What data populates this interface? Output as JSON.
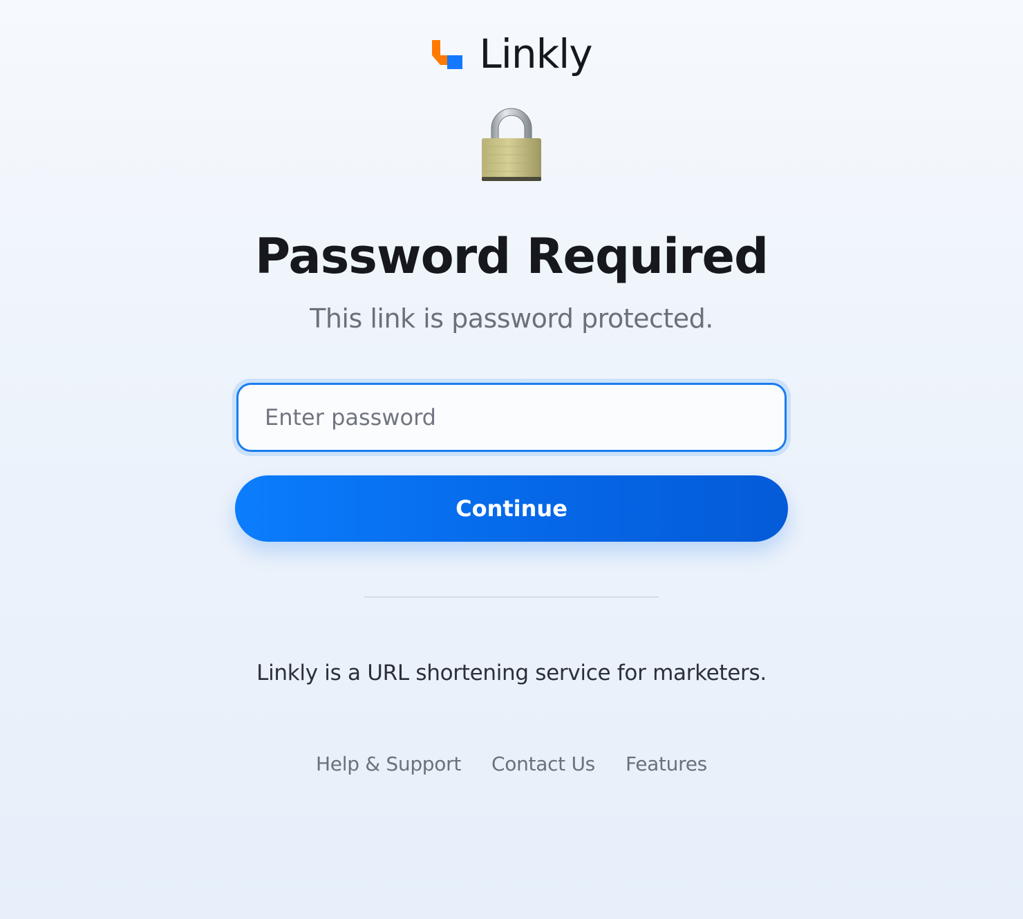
{
  "brand": {
    "name": "Linkly",
    "colors": {
      "orange": "#ff7a00",
      "blue": "#1479ff",
      "accent": "#0a7dfd"
    }
  },
  "lock_icon": "padlock-icon",
  "heading": "Password Required",
  "subheading": "This link is password protected.",
  "password_field": {
    "placeholder": "Enter password",
    "value": ""
  },
  "continue_label": "Continue",
  "tagline": "Linkly is a URL shortening service for marketers.",
  "footer": {
    "links": [
      {
        "label": "Help & Support"
      },
      {
        "label": "Contact Us"
      },
      {
        "label": "Features"
      }
    ]
  }
}
